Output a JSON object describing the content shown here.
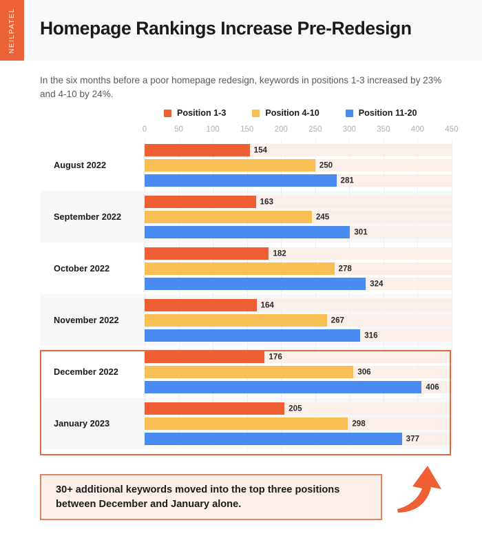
{
  "brand": {
    "label": "NEILPATEL"
  },
  "header": {
    "title": "Homepage Rankings Increase Pre-Redesign"
  },
  "subtitle": "In the six months before a poor homepage redesign, keywords in positions 1-3 increased by 23% and 4-10 by 24%.",
  "callout": {
    "text": "30+ additional keywords moved into the top three positions between December and January alone."
  },
  "colors": {
    "position_1_3": "#ee5f33",
    "position_4_10": "#f8bf54",
    "position_11_20": "#4a8bf2",
    "track": "#fbefe9",
    "band": "#f7f8f9",
    "brand_orange": "#ec6236",
    "highlight_border": "#e06a3d",
    "callout_bg": "#fceee8",
    "callout_border": "#e08361",
    "arrow": "#ee5f33"
  },
  "chart_data": {
    "type": "bar",
    "orientation": "horizontal",
    "title": "Homepage Rankings Increase Pre-Redesign",
    "subtitle": "In the six months before a poor homepage redesign, keywords in positions 1-3 increased by 23% and 4-10 by 24%.",
    "xlabel": "",
    "ylabel": "",
    "xlim": [
      0,
      450
    ],
    "grid": true,
    "legend_position": "top",
    "xticks": [
      0,
      50,
      100,
      150,
      200,
      250,
      300,
      350,
      400,
      450
    ],
    "categories": [
      "August 2022",
      "September 2022",
      "October 2022",
      "November 2022",
      "December 2022",
      "January 2023"
    ],
    "series": [
      {
        "name": "Position 1-3",
        "color": "#ee5f33",
        "values": [
          154,
          163,
          182,
          164,
          176,
          205
        ]
      },
      {
        "name": "Position 4-10",
        "color": "#f8bf54",
        "values": [
          250,
          245,
          278,
          267,
          306,
          298
        ]
      },
      {
        "name": "Position 11-20",
        "color": "#4a8bf2",
        "values": [
          281,
          301,
          324,
          316,
          406,
          377
        ]
      }
    ],
    "highlighted_categories": [
      "December 2022",
      "January 2023"
    ],
    "annotation": "30+ additional keywords moved into the top three positions between December and January alone."
  }
}
